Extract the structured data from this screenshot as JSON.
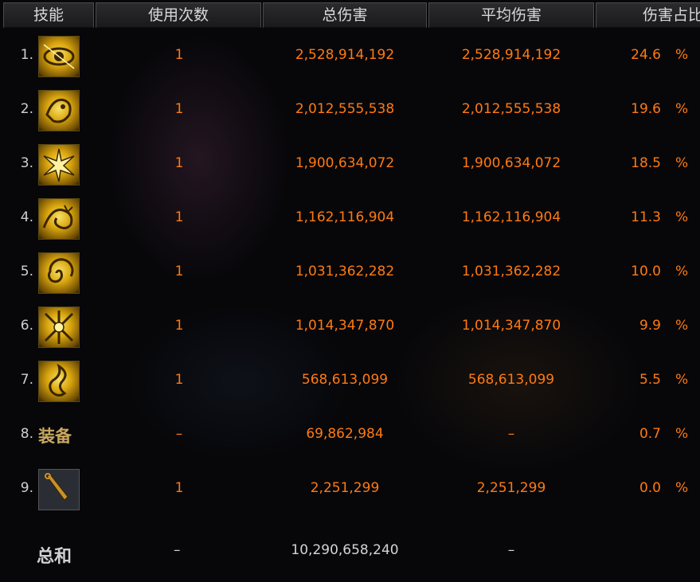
{
  "header": {
    "skill": "技能",
    "uses": "使用次数",
    "total": "总伤害",
    "avg": "平均伤害",
    "pct": "伤害占比"
  },
  "rows": [
    {
      "num": "1.",
      "icon": "eye-skill-icon",
      "uses": "1",
      "total": "2,528,914,192",
      "avg": "2,528,914,192",
      "pct": "24.6",
      "sym": "%"
    },
    {
      "num": "2.",
      "icon": "beast-skill-icon",
      "uses": "1",
      "total": "2,012,555,538",
      "avg": "2,012,555,538",
      "pct": "19.6",
      "sym": "%"
    },
    {
      "num": "3.",
      "icon": "burst-skill-icon",
      "uses": "1",
      "total": "1,900,634,072",
      "avg": "1,900,634,072",
      "pct": "18.5",
      "sym": "%"
    },
    {
      "num": "4.",
      "icon": "dragon-skill-icon",
      "uses": "1",
      "total": "1,162,116,904",
      "avg": "1,162,116,904",
      "pct": "11.3",
      "sym": "%"
    },
    {
      "num": "5.",
      "icon": "vortex-skill-icon",
      "uses": "1",
      "total": "1,031,362,282",
      "avg": "1,031,362,282",
      "pct": "10.0",
      "sym": "%"
    },
    {
      "num": "6.",
      "icon": "cross-blade-skill-icon",
      "uses": "1",
      "total": "1,014,347,870",
      "avg": "1,014,347,870",
      "pct": "9.9",
      "sym": "%"
    },
    {
      "num": "7.",
      "icon": "spirit-skill-icon",
      "uses": "1",
      "total": "568,613,099",
      "avg": "568,613,099",
      "pct": "5.5",
      "sym": "%"
    },
    {
      "num": "8.",
      "equip": "装备",
      "uses": "–",
      "total": "69,862,984",
      "avg": "–",
      "pct": "0.7",
      "sym": "%"
    },
    {
      "num": "9.",
      "icon": "kunai-icon",
      "uses": "1",
      "total": "2,251,299",
      "avg": "2,251,299",
      "pct": "0.0",
      "sym": "%"
    }
  ],
  "sum": {
    "label": "总和",
    "uses": "–",
    "total": "10,290,658,240",
    "avg": "–"
  }
}
